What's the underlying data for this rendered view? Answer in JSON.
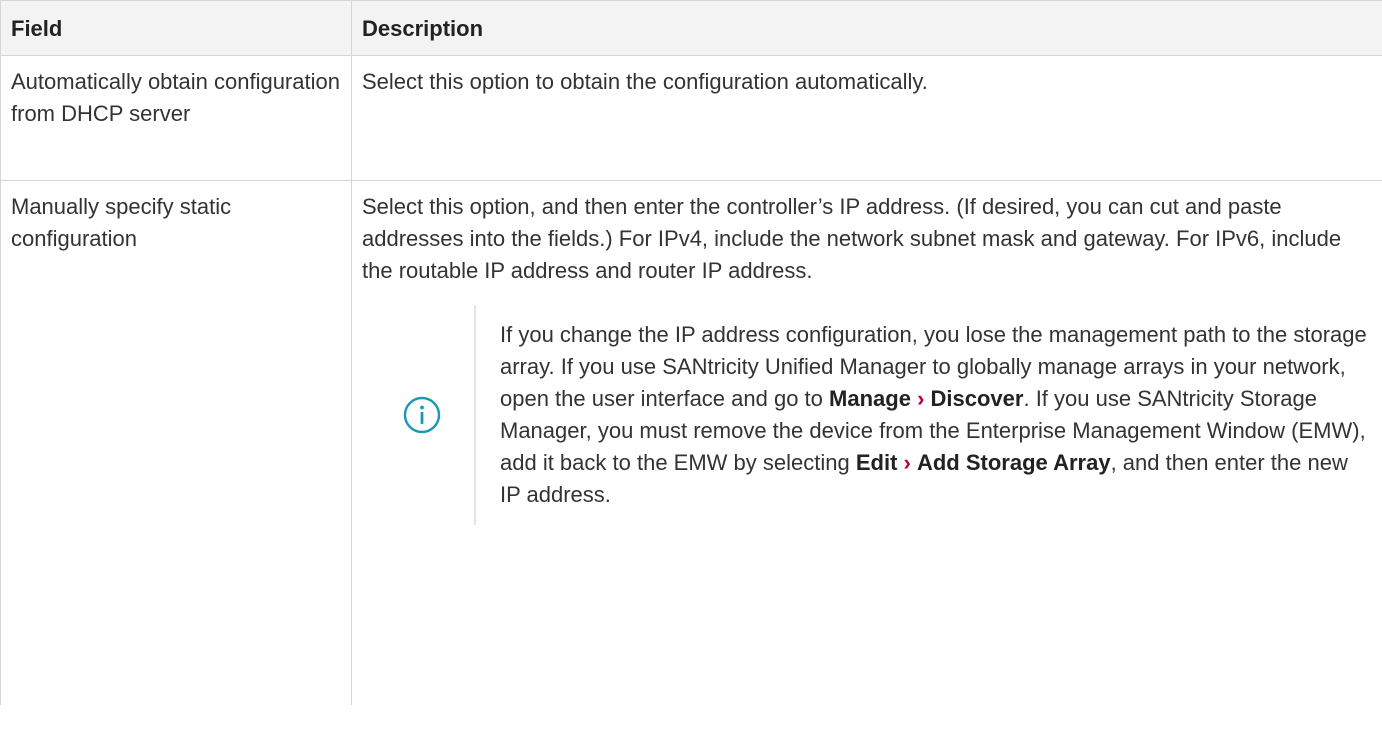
{
  "table": {
    "headers": {
      "field": "Field",
      "description": "Description"
    },
    "rows": [
      {
        "field": "Automatically obtain configuration from DHCP server",
        "description": "Select this option to obtain the configuration automatically."
      },
      {
        "field": "Manually specify static configuration",
        "description": "Select this option, and then enter the controller’s IP address. (If desired, you can cut and paste addresses into the fields.) For IPv4, include the network subnet mask and gateway. For IPv6, include the routable IP address and router IP address.",
        "note": {
          "icon": "info-icon",
          "text_1": "If you change the IP address configuration, you lose the management path to the storage array. If you use SANtricity Unified Manager to globally manage arrays in your network, open the user interface and go to ",
          "menu_1_a": "Manage",
          "separator": "›",
          "menu_1_b": "Discover",
          "text_2": ". If you use SANtricity Storage Manager, you must remove the device from the Enterprise Management Window (EMW), add it back to the EMW by selecting ",
          "menu_2_a": "Edit",
          "menu_2_b": "Add Storage Array",
          "text_3": ", and then enter the new IP address."
        }
      }
    ]
  },
  "colors": {
    "border": "#d6d6d6",
    "header_bg": "#f3f3f3",
    "text": "#333333",
    "menu_separator": "#b3004a",
    "icon": "#1a9ab0"
  }
}
